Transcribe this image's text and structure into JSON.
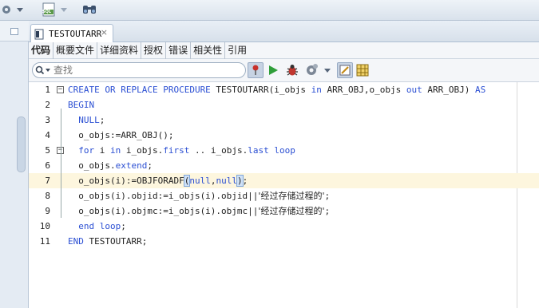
{
  "toolbar": {
    "icons": [
      "gear-icon",
      "dropdown-arrow-icon",
      "sql-file-icon",
      "dropdown-arrow-icon",
      "binoculars-icon"
    ],
    "sql_badge": "SQL"
  },
  "editor": {
    "tab": {
      "title": "TESTOUTARR",
      "close": "×"
    },
    "subtabs": [
      "代码",
      "概要文件",
      "详细资料",
      "授权",
      "错误",
      "相关性",
      "引用"
    ],
    "search": {
      "placeholder": "查找"
    },
    "tools": [
      "pin-icon",
      "run-icon",
      "debug-icon",
      "compile-gear-icon",
      "dropdown-arrow-icon",
      "edit-icon",
      "grid-icon"
    ]
  },
  "code": {
    "current_line": 7,
    "lines": [
      {
        "n": "1",
        "fold": "-",
        "tokens": [
          [
            "kw",
            "CREATE OR REPLACE PROCEDURE"
          ],
          [
            "t",
            " TESTOUTARR(i_objs "
          ],
          [
            "kw",
            "in"
          ],
          [
            "t",
            " ARR_OBJ,o_objs "
          ],
          [
            "kw",
            "out"
          ],
          [
            "t",
            " ARR_OBJ) "
          ],
          [
            "kw",
            "AS"
          ]
        ]
      },
      {
        "n": "2",
        "fold": "",
        "tokens": [
          [
            "kw",
            "BEGIN"
          ]
        ]
      },
      {
        "n": "3",
        "fold": "",
        "tokens": [
          [
            "t",
            "  "
          ],
          [
            "kw",
            "NULL"
          ],
          [
            "t",
            ";"
          ]
        ]
      },
      {
        "n": "4",
        "fold": "",
        "tokens": [
          [
            "t",
            "  o_objs:=ARR_OBJ();"
          ]
        ]
      },
      {
        "n": "5",
        "fold": "-",
        "tokens": [
          [
            "t",
            "  "
          ],
          [
            "kw",
            "for"
          ],
          [
            "t",
            " i "
          ],
          [
            "kw",
            "in"
          ],
          [
            "t",
            " i_objs."
          ],
          [
            "kw",
            "first"
          ],
          [
            "t",
            " .. i_objs."
          ],
          [
            "kw",
            "last"
          ],
          [
            "t",
            " "
          ],
          [
            "kw",
            "loop"
          ]
        ]
      },
      {
        "n": "6",
        "fold": "",
        "tokens": [
          [
            "t",
            "  o_objs."
          ],
          [
            "kw",
            "extend"
          ],
          [
            "t",
            ";"
          ]
        ]
      },
      {
        "n": "7",
        "fold": "",
        "tokens": [
          [
            "t",
            "  o_objs(i):=OBJFORADF"
          ],
          [
            "b",
            "("
          ],
          [
            "kw",
            "null"
          ],
          [
            "t",
            ","
          ],
          [
            "kw",
            "null"
          ],
          [
            "b",
            ")"
          ],
          [
            "t",
            ";"
          ]
        ]
      },
      {
        "n": "8",
        "fold": "",
        "tokens": [
          [
            "t",
            "  o_objs(i).objid:=i_objs(i).objid||"
          ],
          [
            "s",
            "'经过存储过程的'"
          ],
          [
            "t",
            ";"
          ]
        ]
      },
      {
        "n": "9",
        "fold": "",
        "tokens": [
          [
            "t",
            "  o_objs(i).objmc:=i_objs(i).objmc||"
          ],
          [
            "s",
            "'经过存储过程的'"
          ],
          [
            "t",
            ";"
          ]
        ]
      },
      {
        "n": "10",
        "fold": "",
        "tokens": [
          [
            "t",
            "  "
          ],
          [
            "kw",
            "end loop"
          ],
          [
            "t",
            ";"
          ]
        ]
      },
      {
        "n": "11",
        "fold": "",
        "tokens": [
          [
            "kw",
            "END"
          ],
          [
            "t",
            " TESTOUTARR;"
          ]
        ]
      }
    ]
  }
}
